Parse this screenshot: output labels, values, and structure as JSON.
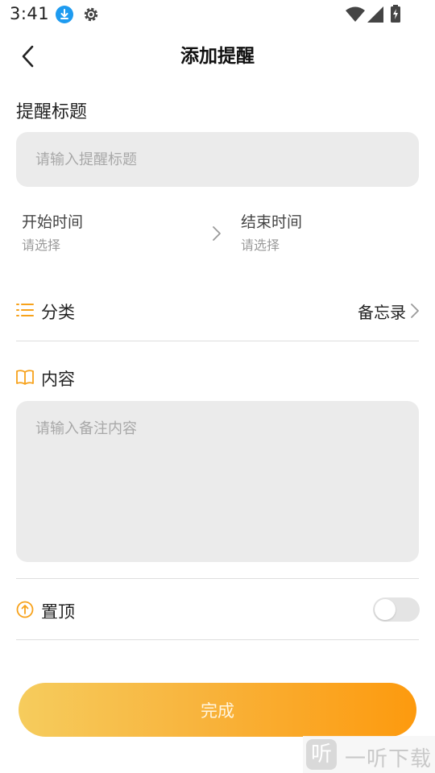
{
  "status_bar": {
    "time": "3:41",
    "icons": [
      "download-icon",
      "gear-icon",
      "wifi-icon",
      "signal-icon",
      "battery-icon"
    ]
  },
  "header": {
    "title": "添加提醒",
    "back_icon": "chevron-left-icon"
  },
  "reminder_title": {
    "label": "提醒标题",
    "placeholder": "请输入提醒标题",
    "value": ""
  },
  "time": {
    "start_label": "开始时间",
    "start_value": "请选择",
    "end_label": "结束时间",
    "end_value": "请选择"
  },
  "category": {
    "icon": "list-icon",
    "label": "分类",
    "value": "备忘录"
  },
  "content": {
    "icon": "book-icon",
    "label": "内容",
    "placeholder": "请输入备注内容",
    "value": ""
  },
  "pin": {
    "icon": "arrow-up-circle-icon",
    "label": "置顶",
    "enabled": false
  },
  "done_button": {
    "label": "完成"
  },
  "watermark": {
    "badge": "听",
    "text": "一听下载"
  },
  "colors": {
    "accent": "#f7a21b",
    "input_bg": "#ebebeb",
    "button_gradient_start": "#f6cc5d",
    "button_gradient_end": "#fd9a0e"
  }
}
